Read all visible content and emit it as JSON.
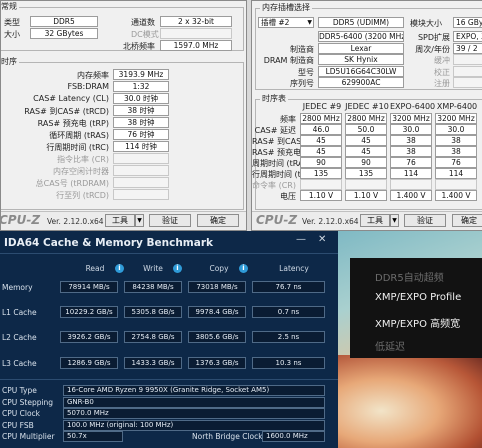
{
  "cpuz_left": {
    "top": {
      "type_label": "类型",
      "type_value": "DDR5",
      "channels_label": "通道数",
      "channels_value": "2 x 32-bit",
      "size_label": "大小",
      "size_value": "32 GBytes",
      "dcmode_label": "DC模式",
      "nb_freq_label": "北桥频率",
      "nb_freq_value": "1597.0 MHz",
      "corner_label": "常规"
    },
    "timings_title": "时序",
    "timings": [
      {
        "label": "内存频率",
        "value": "3193.9 MHz",
        "dim": false
      },
      {
        "label": "FSB:DRAM",
        "value": "1:32",
        "dim": false
      },
      {
        "label": "CAS# Latency (CL)",
        "value": "30.0 时钟",
        "dim": false
      },
      {
        "label": "RAS# 到CAS# (tRCD)",
        "value": "38 时钟",
        "dim": false
      },
      {
        "label": "RAS# 预充电 (tRP)",
        "value": "38 时钟",
        "dim": false
      },
      {
        "label": "循环周期 (tRAS)",
        "value": "76 时钟",
        "dim": false
      },
      {
        "label": "行周期时间 (tRC)",
        "value": "114 时钟",
        "dim": false
      },
      {
        "label": "指令比率 (CR)",
        "value": "",
        "dim": true
      },
      {
        "label": "内存空闲计时器",
        "value": "",
        "dim": true
      },
      {
        "label": "总CAS号 (tRDRAM)",
        "value": "",
        "dim": true
      },
      {
        "label": "行至列 (tRCD)",
        "value": "",
        "dim": true
      }
    ],
    "footer": {
      "logo": "CPU-Z",
      "version": "Ver. 2.12.0.x64",
      "tools": "工具",
      "validate": "验证",
      "ok": "确定"
    }
  },
  "cpuz_right": {
    "slot_group_title": "内存插槽选择",
    "slot_select": "插槽 #2",
    "slot_type": "DDR5 (UDIMM)",
    "module_size_label": "模块大小",
    "module_size_value": "16 GBy",
    "module_rows": [
      {
        "label": "",
        "value": "DDR5-6400 (3200 MHz)",
        "rlabel": "SPD扩展",
        "rvalue": "EXPO, XM"
      },
      {
        "label": "制造商",
        "value": "Lexar",
        "rlabel": "周次/年份",
        "rvalue": "39 / 2"
      },
      {
        "label": "DRAM 制造商",
        "value": "SK Hynix",
        "rlabel": "缓冲",
        "rvalue": ""
      },
      {
        "label": "型号",
        "value": "LD5U16G64C30LW",
        "rlabel": "校正",
        "rvalue": ""
      },
      {
        "label": "序列号",
        "value": "629900AC",
        "rlabel": "注册",
        "rvalue": ""
      }
    ],
    "timings_title": "时序表",
    "columns": [
      "JEDEC #9",
      "JEDEC #10",
      "EXPO-6400",
      "XMP-6400"
    ],
    "rows": [
      {
        "label": "频率",
        "values": [
          "2800 MHz",
          "2800 MHz",
          "3200 MHz",
          "3200 MHz"
        ]
      },
      {
        "label": "CAS# 延迟",
        "values": [
          "46.0",
          "50.0",
          "30.0",
          "30.0"
        ]
      },
      {
        "label": "RAS# 到CAS#",
        "values": [
          "45",
          "45",
          "38",
          "38"
        ]
      },
      {
        "label": "RAS# 预充电",
        "values": [
          "45",
          "45",
          "38",
          "38"
        ]
      },
      {
        "label": "周期时间 (tRAS)",
        "values": [
          "90",
          "90",
          "76",
          "76"
        ]
      },
      {
        "label": "行周期时间 (tRC)",
        "values": [
          "135",
          "135",
          "114",
          "114"
        ]
      },
      {
        "label": "命令率 (CR)",
        "values": [
          "",
          "",
          "",
          ""
        ]
      },
      {
        "label": "电压",
        "values": [
          "1.10 V",
          "1.10 V",
          "1.400 V",
          "1.400 V"
        ]
      }
    ],
    "footer": {
      "logo": "CPU-Z",
      "version": "Ver. 2.12.0.x64",
      "tools": "工具",
      "validate": "验证",
      "ok": "确定"
    }
  },
  "aida": {
    "title": "IDA64 Cache & Memory Benchmark",
    "minimize": "—",
    "close": "✕",
    "headers": {
      "read": "Read",
      "write": "Write",
      "copy": "Copy",
      "latency": "Latency"
    },
    "rows": [
      {
        "label": "Memory",
        "read": "78914 MB/s",
        "write": "84238 MB/s",
        "copy": "73018 MB/s",
        "latency": "76.7 ns"
      },
      {
        "label": "L1 Cache",
        "read": "10229.2 GB/s",
        "write": "5305.8 GB/s",
        "copy": "9978.4 GB/s",
        "latency": "0.7 ns"
      },
      {
        "label": "L2 Cache",
        "read": "3926.2 GB/s",
        "write": "2754.8 GB/s",
        "copy": "3805.6 GB/s",
        "latency": "2.5 ns"
      },
      {
        "label": "L3 Cache",
        "read": "1286.9 GB/s",
        "write": "1433.3 GB/s",
        "copy": "1376.3 GB/s",
        "latency": "10.3 ns"
      }
    ],
    "info": [
      {
        "label": "CPU Type",
        "value": "16-Core AMD Ryzen 9 9950X  (Granite Ridge, Socket AM5)"
      },
      {
        "label": "CPU Stepping",
        "value": "GNR-B0"
      },
      {
        "label": "CPU Clock",
        "value": "5070.0 MHz"
      },
      {
        "label": "CPU FSB",
        "value": "100.0 MHz  (original: 100 MHz)"
      }
    ],
    "multiplier_label": "CPU Multiplier",
    "multiplier_value": "50.7x",
    "nb_clock_label": "North Bridge Clock",
    "nb_clock_value": "1600.0 MHz"
  },
  "bios_menu": {
    "items": [
      {
        "label": "DDR5自动超频",
        "state": "dim"
      },
      {
        "label": "XMP/EXPO Profile",
        "state": "normal"
      },
      {
        "label": "XMP/EXPO 高频宽",
        "state": "normal"
      },
      {
        "label": "低延迟",
        "state": "dim"
      }
    ]
  }
}
